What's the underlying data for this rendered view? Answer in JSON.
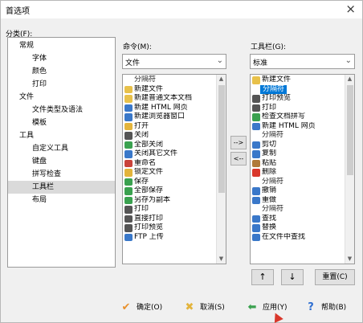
{
  "window": {
    "title": "首选项",
    "close_label": "×"
  },
  "category": {
    "label": "分类(F):",
    "items": [
      {
        "label": "常规",
        "level": 0,
        "selected": false
      },
      {
        "label": "字体",
        "level": 1,
        "selected": false
      },
      {
        "label": "颜色",
        "level": 1,
        "selected": false
      },
      {
        "label": "打印",
        "level": 1,
        "selected": false
      },
      {
        "label": "文件",
        "level": 0,
        "selected": false
      },
      {
        "label": "文件类型及语法",
        "level": 1,
        "selected": false
      },
      {
        "label": "模板",
        "level": 1,
        "selected": false
      },
      {
        "label": "工具",
        "level": 0,
        "selected": false
      },
      {
        "label": "自定义工具",
        "level": 1,
        "selected": false
      },
      {
        "label": "键盘",
        "level": 1,
        "selected": false
      },
      {
        "label": "拼写检查",
        "level": 1,
        "selected": false
      },
      {
        "label": "工具栏",
        "level": 1,
        "selected": true
      },
      {
        "label": "布局",
        "level": 1,
        "selected": false
      }
    ]
  },
  "commands": {
    "label": "命令(M):",
    "combo_value": "文件",
    "items": [
      {
        "label": "分隔符",
        "icon": "separator",
        "color": ""
      },
      {
        "label": "新建文件",
        "icon": "new-file-icon",
        "color": "#e8c14a"
      },
      {
        "label": "新建普通文本文档",
        "icon": "new-text-icon",
        "color": "#e8c14a"
      },
      {
        "label": "新建 HTML 网页",
        "icon": "html-icon",
        "color": "#3a78c9"
      },
      {
        "label": "新建浏览器窗口",
        "icon": "browser-icon",
        "color": "#3a78c9"
      },
      {
        "label": "打开",
        "icon": "folder-icon",
        "color": "#e3b43c"
      },
      {
        "label": "关闭",
        "icon": "close-file-icon",
        "color": "#555555"
      },
      {
        "label": "全部关闭",
        "icon": "close-all-icon",
        "color": "#3aa14f"
      },
      {
        "label": "关闭其它文件",
        "icon": "close-others-icon",
        "color": "#3a78c9"
      },
      {
        "label": "重命名",
        "icon": "rename-icon",
        "color": "#c9423a"
      },
      {
        "label": "锁定文件",
        "icon": "lock-icon",
        "color": "#e3b43c"
      },
      {
        "label": "保存",
        "icon": "save-icon",
        "color": "#3aa14f"
      },
      {
        "label": "全部保存",
        "icon": "save-all-icon",
        "color": "#3aa14f"
      },
      {
        "label": "另存为副本",
        "icon": "save-copy-icon",
        "color": "#3aa14f"
      },
      {
        "label": "打印",
        "icon": "print-icon",
        "color": "#555555"
      },
      {
        "label": "直接打印",
        "icon": "direct-print-icon",
        "color": "#555555"
      },
      {
        "label": "打印预览",
        "icon": "print-preview-icon",
        "color": "#555555"
      },
      {
        "label": "FTP 上传",
        "icon": "ftp-upload-icon",
        "color": "#3a78c9"
      }
    ]
  },
  "toolbar": {
    "label": "工具栏(G):",
    "combo_value": "标准",
    "items": [
      {
        "label": "新建文件",
        "icon": "new-file-icon",
        "color": "#e8c14a",
        "selected": false
      },
      {
        "label": "分隔符",
        "icon": "separator",
        "color": "",
        "selected": true
      },
      {
        "label": "打印预览",
        "icon": "print-preview-icon",
        "color": "#555555",
        "selected": false
      },
      {
        "label": "打印",
        "icon": "print-icon",
        "color": "#555555",
        "selected": false
      },
      {
        "label": "检查文档拼写",
        "icon": "spellcheck-icon",
        "color": "#3aa14f",
        "selected": false
      },
      {
        "label": "新建 HTML 网页",
        "icon": "html-icon",
        "color": "#3a78c9",
        "selected": false
      },
      {
        "label": "分隔符",
        "icon": "separator",
        "color": "",
        "selected": false
      },
      {
        "label": "剪切",
        "icon": "cut-icon",
        "color": "#3a78c9",
        "selected": false
      },
      {
        "label": "复制",
        "icon": "copy-icon",
        "color": "#3a78c9",
        "selected": false
      },
      {
        "label": "粘贴",
        "icon": "paste-icon",
        "color": "#b07a3a",
        "selected": false
      },
      {
        "label": "删除",
        "icon": "delete-icon",
        "color": "#d9372b",
        "selected": false
      },
      {
        "label": "分隔符",
        "icon": "separator",
        "color": "",
        "selected": false
      },
      {
        "label": "撤销",
        "icon": "undo-icon",
        "color": "#3a78c9",
        "selected": false
      },
      {
        "label": "重做",
        "icon": "redo-icon",
        "color": "#3a78c9",
        "selected": false
      },
      {
        "label": "分隔符",
        "icon": "separator",
        "color": "",
        "selected": false
      },
      {
        "label": "查找",
        "icon": "find-icon",
        "color": "#3a78c9",
        "selected": false
      },
      {
        "label": "替换",
        "icon": "replace-icon",
        "color": "#3a78c9",
        "selected": false
      },
      {
        "label": "在文件中查找",
        "icon": "find-in-files-icon",
        "color": "#3a78c9",
        "selected": false
      }
    ]
  },
  "move_buttons": {
    "add": "-->",
    "remove": "<--"
  },
  "order_buttons": {
    "up": "↑",
    "down": "↓",
    "reset": "重置(C)"
  },
  "footer": {
    "ok": "确定(O)",
    "cancel": "取消(S)",
    "apply": "应用(Y)",
    "help": "帮助(B)"
  },
  "colors": {
    "ok_icon": "#e8902c",
    "cancel_icon": "#e3b43c",
    "apply_icon": "#3aa14f",
    "help_icon": "#2f6fd1",
    "selection": "#0078d7"
  }
}
